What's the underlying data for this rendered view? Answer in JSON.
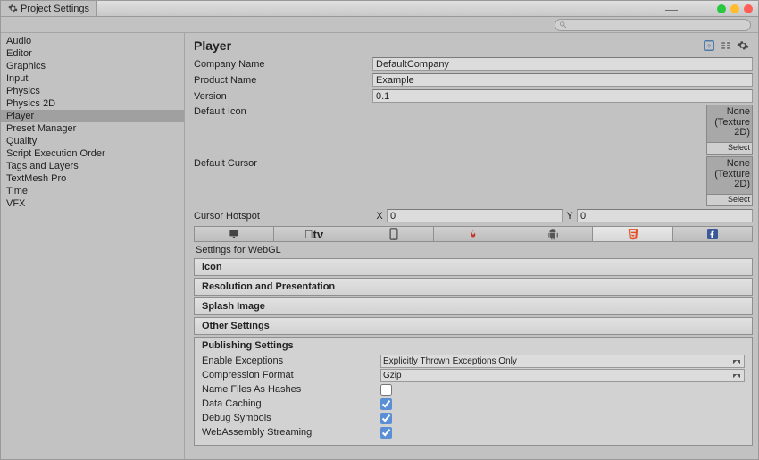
{
  "window": {
    "title": "Project Settings"
  },
  "search": {
    "placeholder": ""
  },
  "sidebar": {
    "items": [
      {
        "label": "Audio"
      },
      {
        "label": "Editor"
      },
      {
        "label": "Graphics"
      },
      {
        "label": "Input"
      },
      {
        "label": "Physics"
      },
      {
        "label": "Physics 2D"
      },
      {
        "label": "Player",
        "selected": true
      },
      {
        "label": "Preset Manager"
      },
      {
        "label": "Quality"
      },
      {
        "label": "Script Execution Order"
      },
      {
        "label": "Tags and Layers"
      },
      {
        "label": "TextMesh Pro"
      },
      {
        "label": "Time"
      },
      {
        "label": "VFX"
      }
    ]
  },
  "player": {
    "heading": "Player",
    "company_name_label": "Company Name",
    "company_name": "DefaultCompany",
    "product_name_label": "Product Name",
    "product_name": "Example",
    "version_label": "Version",
    "version": "0.1",
    "default_icon_label": "Default Icon",
    "default_cursor_label": "Default Cursor",
    "texture_none": "None (Texture 2D)",
    "texture_select": "Select",
    "cursor_hotspot_label": "Cursor Hotspot",
    "cursor_x_label": "X",
    "cursor_x": "0",
    "cursor_y_label": "Y",
    "cursor_y": "0"
  },
  "platforms": {
    "items": [
      {
        "name": "standalone"
      },
      {
        "name": "apple-tv"
      },
      {
        "name": "ios"
      },
      {
        "name": "fire"
      },
      {
        "name": "android"
      },
      {
        "name": "webgl",
        "active": true
      },
      {
        "name": "facebook"
      }
    ],
    "settings_for": "Settings for WebGL"
  },
  "foldouts": {
    "icon": "Icon",
    "resolution": "Resolution and Presentation",
    "splash": "Splash Image",
    "other": "Other Settings"
  },
  "publishing": {
    "title": "Publishing Settings",
    "enable_exceptions_label": "Enable Exceptions",
    "enable_exceptions": "Explicitly Thrown Exceptions Only",
    "compression_label": "Compression Format",
    "compression": "Gzip",
    "name_files_label": "Name Files As Hashes",
    "name_files": false,
    "data_caching_label": "Data Caching",
    "data_caching": true,
    "debug_symbols_label": "Debug Symbols",
    "debug_symbols": true,
    "wasm_streaming_label": "WebAssembly Streaming",
    "wasm_streaming": true
  }
}
